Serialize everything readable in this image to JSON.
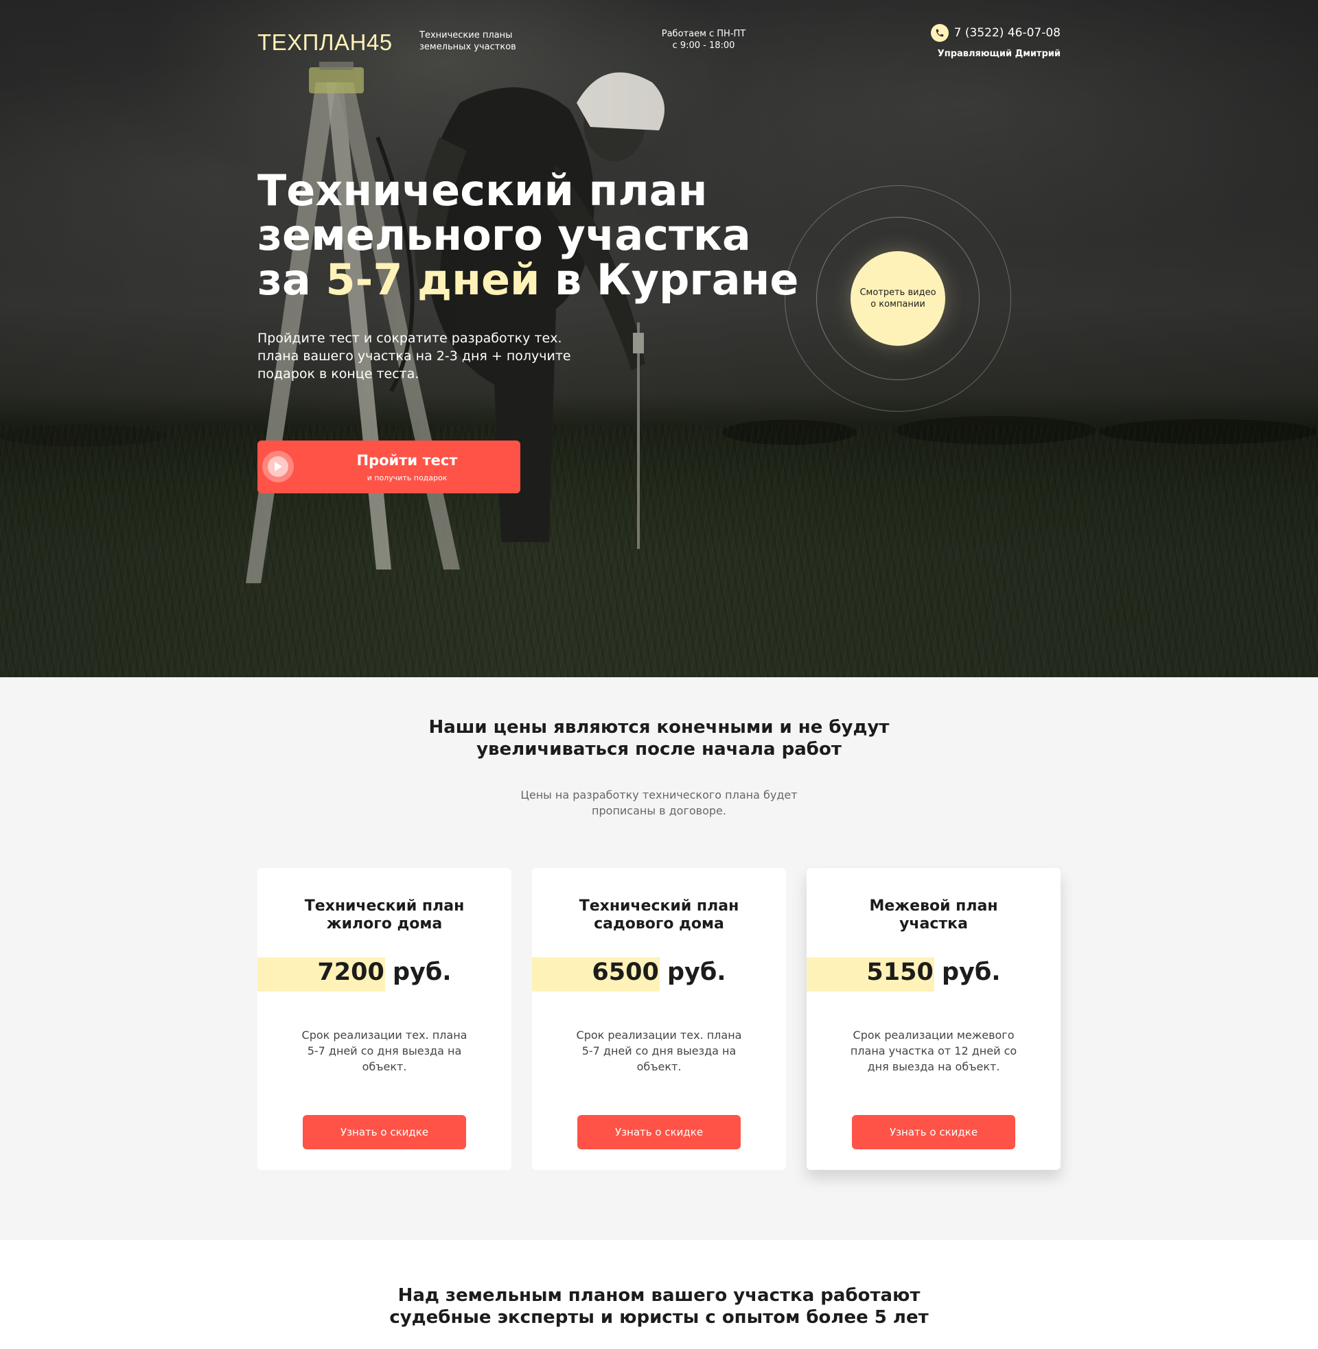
{
  "header": {
    "logo": "ТЕХПЛАН45",
    "tagline_line1": "Технические планы",
    "tagline_line2": "земельных участков",
    "hours_line1": "Работаем с ПН-ПТ",
    "hours_line2": "с 9:00 - 18:00",
    "phone": "7 (3522) 46-07-08",
    "phone_icon": "phone-icon",
    "manager": "Управляющий Дмитрий"
  },
  "hero": {
    "title_line1": "Технический план",
    "title_line2": "земельного участка",
    "title_prefix": "за ",
    "title_accent": "5-7 дней",
    "title_suffix": " в Кургане",
    "subtitle_line1": "Пройдите тест и сократите разработку тех.",
    "subtitle_line2": "плана вашего участка на 2-3 дня + получите",
    "subtitle_line3": "подарок в конце теста.",
    "cta_title": "Пройти тест",
    "cta_small": "и получить подарок",
    "cta_icon": "play-icon",
    "video_line1": "Смотреть видео",
    "video_line2": "о компании"
  },
  "prices": {
    "title_line1": "Наши цены являются конечными и не будут",
    "title_line2": "увеличиваться после начала работ",
    "subtitle_line1": "Цены на разработку технического плана будет",
    "subtitle_line2": "прописаны в договоре.",
    "cards": [
      {
        "title_line1": "Технический план",
        "title_line2": "жилого дома",
        "price": "7200",
        "currency": " руб.",
        "desc_line1": "Срок реализации тех. плана",
        "desc_line2": "5-7 дней со дня выезда на",
        "desc_line3": "объект.",
        "button": "Узнать о скидке"
      },
      {
        "title_line1": "Технический план",
        "title_line2": "садового дома",
        "price": "6500",
        "currency": " руб.",
        "desc_line1": "Срок реализации тех. плана",
        "desc_line2": "5-7 дней со дня выезда на",
        "desc_line3": "объект.",
        "button": "Узнать о скидке"
      },
      {
        "title_line1": "Межевой план",
        "title_line2": "участка",
        "price": "5150",
        "currency": " руб.",
        "desc_line1": "Срок реализации межевого",
        "desc_line2": "плана участка от 12 дней со",
        "desc_line3": "дня выезда на объект.",
        "button": "Узнать о скидке"
      }
    ]
  },
  "experts": {
    "title_line1": "Над земельным планом вашего участка работают",
    "title_line2": "судебные эксперты и юристы с опытом более 5 лет"
  },
  "colors": {
    "accent_yellow": "#fff2b8",
    "accent_red": "#ff5347",
    "text_dark": "#1c1c1c",
    "section_bg": "#f5f5f5"
  }
}
